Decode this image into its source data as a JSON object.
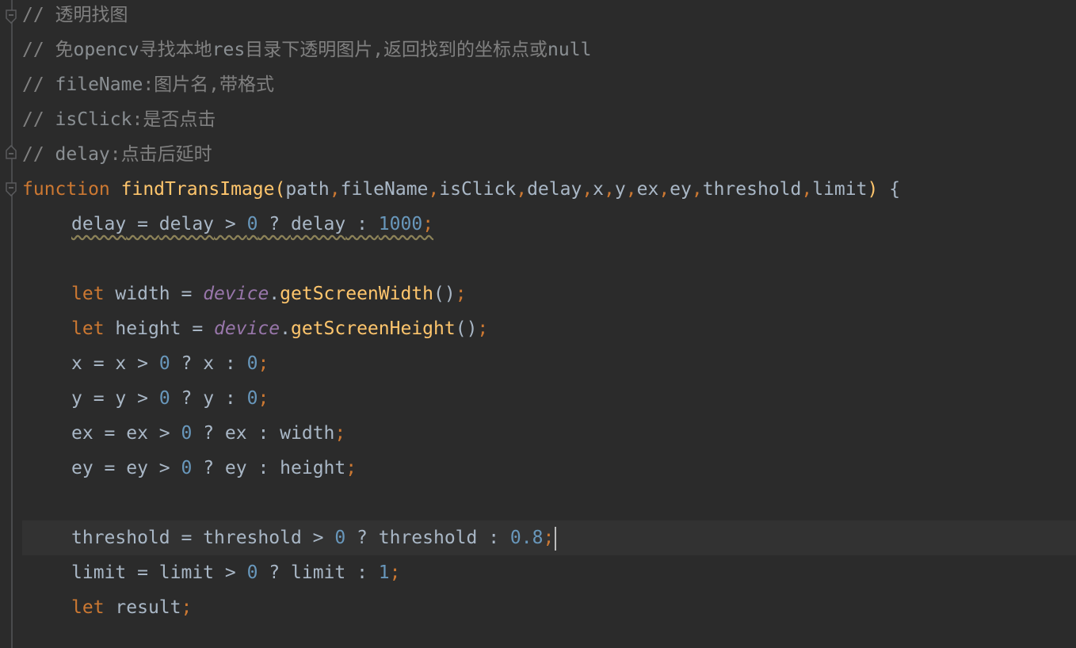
{
  "editor": {
    "language": "javascript",
    "comments": [
      "// 透明找图",
      "// 免opencv寻找本地res目录下透明图片,返回找到的坐标点或null",
      "// fileName:图片名,带格式",
      "// isClick:是否点击",
      "// delay:点击后延时"
    ],
    "function_decl": {
      "keyword": "function",
      "name": "findTransImage",
      "params": [
        "path",
        "fileName",
        "isClick",
        "delay",
        "x",
        "y",
        "ex",
        "ey",
        "threshold",
        "limit"
      ],
      "open_brace": "{"
    },
    "lines": {
      "delay": {
        "lhs": "delay",
        "cond": "delay",
        "zero": "0",
        "then": "delay",
        "else": "1000"
      },
      "width": {
        "kw": "let",
        "name": "width",
        "obj": "device",
        "method": "getScreenWidth"
      },
      "height": {
        "kw": "let",
        "name": "height",
        "obj": "device",
        "method": "getScreenHeight"
      },
      "x": {
        "lhs": "x",
        "cond": "x",
        "zero": "0",
        "then": "x",
        "else": "0"
      },
      "y": {
        "lhs": "y",
        "cond": "y",
        "zero": "0",
        "then": "y",
        "else": "0"
      },
      "ex": {
        "lhs": "ex",
        "cond": "ex",
        "zero": "0",
        "then": "ex",
        "else": "width"
      },
      "ey": {
        "lhs": "ey",
        "cond": "ey",
        "zero": "0",
        "then": "ey",
        "else": "height"
      },
      "threshold": {
        "lhs": "threshold",
        "cond": "threshold",
        "zero": "0",
        "then": "threshold",
        "else": "0.8"
      },
      "limit": {
        "lhs": "limit",
        "cond": "limit",
        "zero": "0",
        "then": "limit",
        "else": "1"
      },
      "result": {
        "kw": "let",
        "name": "result"
      }
    },
    "colors": {
      "background": "#2b2b2b",
      "current_line": "#323232",
      "keyword": "#cc7832",
      "function_name": "#ffc66d",
      "number": "#6897bb",
      "comment": "#808080",
      "global": "#9876aa",
      "identifier": "#a9b7c6"
    }
  }
}
